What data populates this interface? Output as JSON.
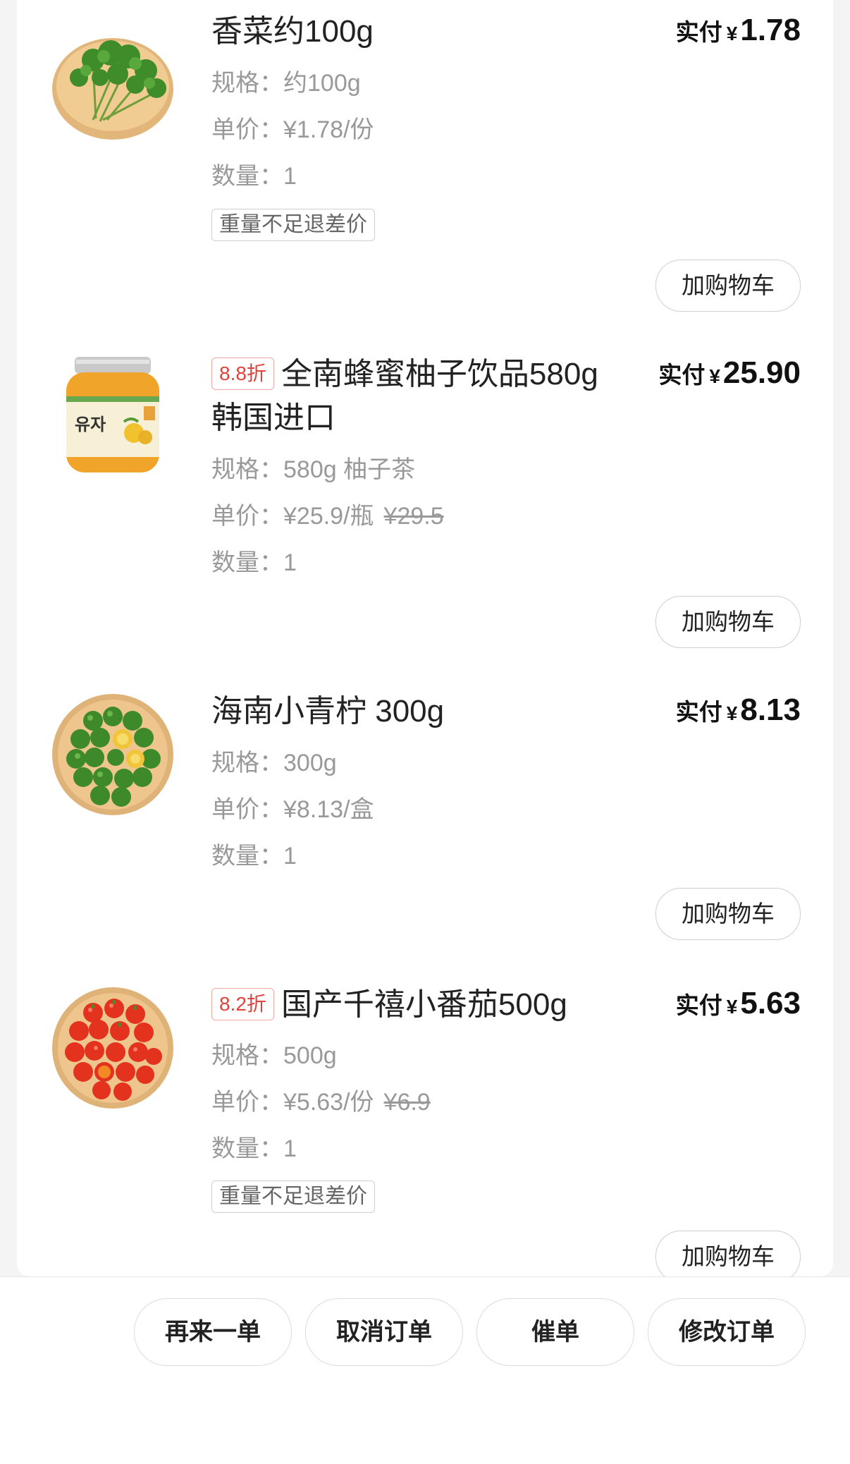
{
  "items": [
    {
      "name": "香菜约100g",
      "discount": "",
      "spec": "规格：约100g",
      "unit_price": "单价：¥1.78/份",
      "original_price": "",
      "qty": "数量：1",
      "tag": "重量不足退差价",
      "paid_label": "实付",
      "currency": "¥",
      "paid_amount": "1.78",
      "cart_label": "加购物车",
      "image": "coriander-image"
    },
    {
      "name": "全南蜂蜜柚子饮品580g 韩国进口",
      "discount": "8.8折",
      "spec": "规格：580g 柚子茶",
      "unit_price": "单价：¥25.9/瓶",
      "original_price": "¥29.5",
      "qty": "数量：1",
      "tag": "",
      "paid_label": "实付",
      "currency": "¥",
      "paid_amount": "25.90",
      "cart_label": "加购物车",
      "image": "yuzu-jar-image"
    },
    {
      "name": "海南小青柠 300g",
      "discount": "",
      "spec": "规格：300g",
      "unit_price": "单价：¥8.13/盒",
      "original_price": "",
      "qty": "数量：1",
      "tag": "",
      "paid_label": "实付",
      "currency": "¥",
      "paid_amount": "8.13",
      "cart_label": "加购物车",
      "image": "lime-plate-image"
    },
    {
      "name": "国产千禧小番茄500g",
      "discount": "8.2折",
      "spec": "规格：500g",
      "unit_price": "单价：¥5.63/份",
      "original_price": "¥6.9",
      "qty": "数量：1",
      "tag": "重量不足退差价",
      "paid_label": "实付",
      "currency": "¥",
      "paid_amount": "5.63",
      "cart_label": "加购物车",
      "image": "cherry-tomato-image"
    }
  ],
  "bottom_bar": {
    "reorder": "再来一单",
    "cancel": "取消订单",
    "urge": "催单",
    "modify": "修改订单"
  },
  "colors": {
    "discount_red": "#e0433a",
    "text_primary": "#222222",
    "text_muted": "#999999"
  }
}
